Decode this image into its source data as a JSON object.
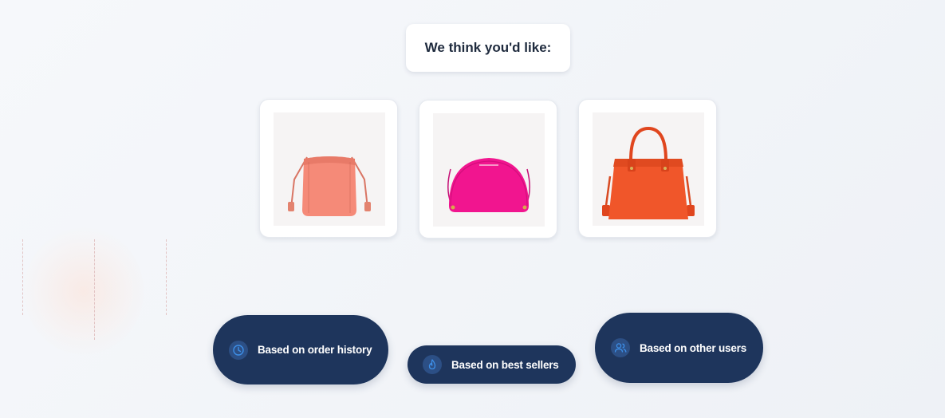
{
  "heading": {
    "text": "We think you'd like:"
  },
  "products": [
    {
      "name": "coral-crossbody-bag",
      "color": "#f58a78"
    },
    {
      "name": "pink-dome-crossbody-bag",
      "color": "#f1158f"
    },
    {
      "name": "orange-satchel-bag",
      "color": "#f0562a"
    }
  ],
  "recommendation_sources": {
    "order_history": {
      "label": "Based on order history",
      "icon": "clock-icon"
    },
    "best_sellers": {
      "label": "Based on best sellers",
      "icon": "flame-icon"
    },
    "other_users": {
      "label": "Based on other users",
      "icon": "users-icon"
    }
  },
  "colors": {
    "pill_background": "#1e355c",
    "icon_accent": "#3d8fe8",
    "heading_text": "#1e2a3d"
  }
}
